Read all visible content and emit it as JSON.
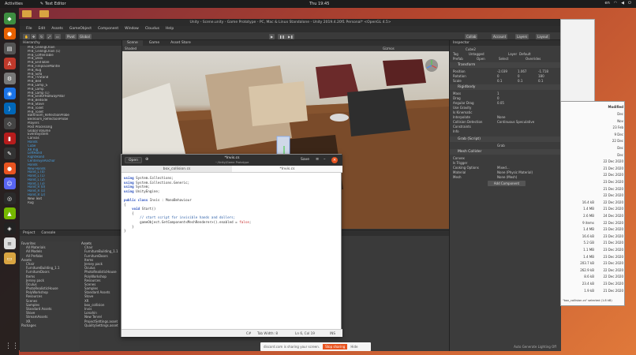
{
  "topbar": {
    "activities": "Activities",
    "app_name": "Text Editor",
    "clock": "Thu 19:45",
    "tray": [
      "en",
      "wifi",
      "vol",
      "pwr"
    ]
  },
  "unity": {
    "title": "Unity - Scene.unity - Game Prototype - PC, Mac & Linux Standalone - Unity 2019.4.20f1 Personal* <OpenGL 4.5>",
    "menu": [
      "File",
      "Edit",
      "Assets",
      "GameObject",
      "Component",
      "Window",
      "Cloudus",
      "Help"
    ],
    "toolbar": {
      "pivot": "Pivot",
      "global": "Global",
      "collab": "Collab",
      "account": "Account",
      "layers": "Layers",
      "layout": "Layout"
    },
    "hierarchy_tab": "Hierarchy",
    "hierarchy_rows": [
      "PFB_CeilingChain",
      "PFB_CeilingChain (1)",
      "PFB_CoffeeTable",
      "PFB_Desk",
      "PFB_EndTable",
      "PFB_FireplaceMantle",
      "PFB_Rug",
      "PFB_Sofa",
      "PFB_TVStand",
      "PFB_Bed",
      "PFB_Lamp_S",
      "PFB_Lamp",
      "PFB_Lamp (1)",
      "PFB_EndOfHallwayPillar",
      "PFB_Bedside",
      "PFB_Stove",
      "PFB_Toilet",
      "PFB_Toilet",
      "Bathroom_ReflectionProbe",
      "Bedroom_ReflectionProbe",
      "Players",
      "Post Processing",
      "Global Volume",
      "EventSystem",
      "Canvas",
      "Hands",
      "Cube",
      "XR Rig",
      "LeftHand",
      "RightHand",
      "CenterEyeAnchor",
      "Hands",
      "New Hands",
      "Hand_L (0)",
      "Hand_L (1)",
      "Hand_L (2)",
      "Hand_L (3)",
      "Hand_R (0)",
      "Hand_R (1)",
      "Hand_R (2)",
      "New Text",
      "Rug"
    ],
    "scene_tabs": [
      "Scene",
      "Game",
      "Asset Store"
    ],
    "scene_shading": "Shaded",
    "scene_gizmos": "Gizmos",
    "project_tabs": [
      "Project",
      "Console"
    ],
    "project_left": [
      "Favorites",
      "All Materials",
      "All Models",
      "All Prefabs",
      "Assets",
      "Chair",
      "FurnitureBuilding_1.1",
      "FurnitureDoors",
      "Items",
      "Jersey pack",
      "Oculus",
      "PhotoRealisticHouse",
      "PolyWorkshop",
      "Resources",
      "Scenes",
      "Samples",
      "Standard Assets",
      "Stove",
      "StreamAssets",
      "XR",
      "Packages"
    ],
    "project_right_header": "Assets",
    "project_right": [
      "Chair",
      "FurnitureBuilding_1.1",
      "FurnitureDoors",
      "Items",
      "Jersey pack",
      "Oculus",
      "PhotoRealisticHouse",
      "PolyWorkshop",
      "Resources",
      "Scenes",
      "Samples",
      "Standard Assets",
      "Stove",
      "XR",
      "box_collision",
      "Invis",
      "Lonahin",
      "New Tenrel",
      "ProjectSettings.asset",
      "QualitySettings.asset"
    ],
    "status_right": "Auto Generate Lighting Off"
  },
  "inspector": {
    "tab": "Inspector",
    "object_name": "Cube2",
    "tag_label": "Tag",
    "tag_value": "Untagged",
    "layer_label": "Layer",
    "layer_value": "Default",
    "prefab_label": "Prefab",
    "prefab_buttons": [
      "Open",
      "Select",
      "Overrides"
    ],
    "transform": "Transform",
    "position": {
      "label": "Position",
      "x": "-2.039",
      "y": "1.067",
      "z": "-1.718"
    },
    "rotation": {
      "label": "Rotation",
      "x": "0",
      "y": "0",
      "z": "180"
    },
    "scale": {
      "label": "Scale",
      "x": "0.1",
      "y": "0.1",
      "z": "0.1"
    },
    "rigidbody": "Rigidbody",
    "rb_rows": [
      {
        "label": "Mass",
        "value": "1"
      },
      {
        "label": "Drag",
        "value": "0"
      },
      {
        "label": "Angular Drag",
        "value": "0.05"
      },
      {
        "label": "Use Gravity",
        "value": ""
      },
      {
        "label": "Is Kinematic",
        "value": ""
      },
      {
        "label": "Interpolate",
        "value": "None"
      },
      {
        "label": "Collision Detection",
        "value": "Continuous Speculative"
      },
      {
        "label": "Constraints",
        "value": ""
      },
      {
        "label": "Info",
        "value": ""
      }
    ],
    "script_comp": "Grab (Script)",
    "script_value": "Grab",
    "mesh_collider": "Mesh Collider",
    "mc_rows": [
      {
        "label": "Convex",
        "value": ""
      },
      {
        "label": "Is Trigger",
        "value": ""
      },
      {
        "label": "Cooking Options",
        "value": "Mixed..."
      },
      {
        "label": "Material",
        "value": "None (Physic Material)"
      },
      {
        "label": "Mesh",
        "value": "None (Mesh)"
      }
    ],
    "add_component": "Add Component"
  },
  "editor": {
    "open_label": "Open",
    "title": "*Invis.cs",
    "subtitle": "~/Unity/Game Prototype",
    "save_label": "Save",
    "tabs": [
      "box_collision.cs",
      "*Invis.cs"
    ],
    "code": [
      {
        "t": "kw",
        "text": "using"
      },
      {
        "t": "plain",
        "text": " System.Collections;\n"
      },
      {
        "t": "kw",
        "text": "using"
      },
      {
        "t": "plain",
        "text": " System.Collections.Generic;\n"
      },
      {
        "t": "kw",
        "text": "using"
      },
      {
        "t": "plain",
        "text": " System;\n"
      },
      {
        "t": "kw",
        "text": "using"
      },
      {
        "t": "plain",
        "text": " UnityEngine;\n\n"
      },
      {
        "t": "kw",
        "text": "public class"
      },
      {
        "t": "plain",
        "text": " Invis : MonoBehaviour\n{\n    "
      },
      {
        "t": "kw",
        "text": "void"
      },
      {
        "t": "plain",
        "text": " Start()\n    {\n        "
      },
      {
        "t": "cm",
        "text": "// start script for invisible hands and dollers;"
      },
      {
        "t": "plain",
        "text": "\n        gameObject.GetComponent<MeshRenderer>().enabled = "
      },
      {
        "t": "st",
        "text": "false"
      },
      {
        "t": "plain",
        "text": ";\n    }\n}\n"
      }
    ],
    "status": {
      "lang": "C#",
      "tab_width": "Tab Width: 8",
      "pos": "Ln 6, Col 19",
      "ins": "INS"
    }
  },
  "files": {
    "header": "Modified",
    "rows": [
      {
        "name": "",
        "val": "Dec"
      },
      {
        "name": "",
        "val": "Nov"
      },
      {
        "name": "",
        "val": "23 Feb"
      },
      {
        "name": "",
        "val": "9 Dec"
      },
      {
        "name": "",
        "val": "22 Dec"
      },
      {
        "name": "",
        "val": "Dec"
      },
      {
        "name": "",
        "val": "Dec"
      },
      {
        "name": "",
        "val": "22 Dec 2020"
      },
      {
        "name": "",
        "val": "21 Dec 2020"
      },
      {
        "name": "",
        "val": "22 Dec 2020"
      },
      {
        "name": "",
        "val": "23 Dec 2020"
      },
      {
        "name": "",
        "val": "21 Dec 2020"
      },
      {
        "name": "",
        "val": "22 Dec 2020"
      },
      {
        "name": "16.4 kB",
        "val": "22 Dec 2020"
      },
      {
        "name": "1.4 MB",
        "val": "21 Dec 2020"
      },
      {
        "name": "2.6 MB",
        "val": "24 Dec 2020"
      },
      {
        "name": "9 items",
        "val": "22 Dec 2020"
      },
      {
        "name": "1.4 MB",
        "val": "23 Dec 2020"
      },
      {
        "name": "16.6 kB",
        "val": "23 Dec 2020"
      },
      {
        "name": "5.2 GB",
        "val": "21 Dec 2020"
      },
      {
        "name": "1.1 MB",
        "val": "23 Dec 2020"
      },
      {
        "name": "1.4 MB",
        "val": "23 Dec 2020"
      },
      {
        "name": "203.7 kB",
        "val": "23 Dec 2020"
      },
      {
        "name": "262.9 kB",
        "val": "22 Dec 2020"
      },
      {
        "name": "8.6 kB",
        "val": "22 Dec 2020"
      },
      {
        "name": "23.4 kB",
        "val": "23 Dec 2020"
      },
      {
        "name": "1.9 kB",
        "val": "21 Dec 2020"
      }
    ],
    "footer": "\"box_collision.cs\" selected (1.8 kB)"
  },
  "share": {
    "message": "discord.com is sharing your screen.",
    "stop": "Stop sharing",
    "hide": "Hide"
  },
  "colors": {
    "accent": "#e95420",
    "unity_bg": "#383838",
    "selection": "#4a9fe0"
  }
}
